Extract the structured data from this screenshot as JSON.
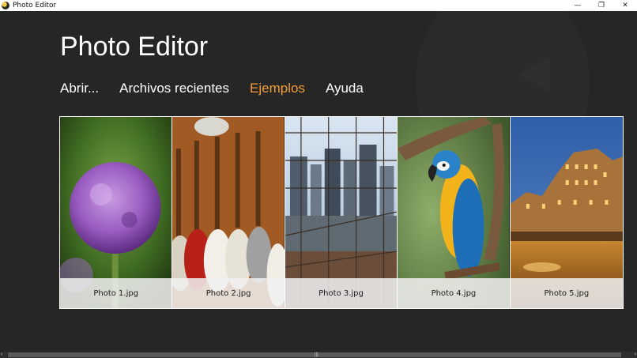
{
  "window": {
    "title": "Photo Editor",
    "controls": {
      "minimize": "—",
      "maximize": "❐",
      "close": "✕"
    }
  },
  "app": {
    "title": "Photo Editor"
  },
  "nav": {
    "items": [
      {
        "label": "Abrir..."
      },
      {
        "label": "Archivos recientes"
      },
      {
        "label": "Ejemplos"
      },
      {
        "label": "Ayuda"
      }
    ],
    "active": "Ejemplos",
    "active_color": "#f39c3a"
  },
  "gallery": {
    "items": [
      {
        "caption": "Photo 1.jpg"
      },
      {
        "caption": "Photo 2.jpg"
      },
      {
        "caption": "Photo 3.jpg"
      },
      {
        "caption": "Photo 4.jpg"
      },
      {
        "caption": "Photo 5.jpg"
      }
    ]
  },
  "scrollbar": {
    "left_arrow": "‹",
    "right_arrow": "›",
    "grip": "|||"
  }
}
